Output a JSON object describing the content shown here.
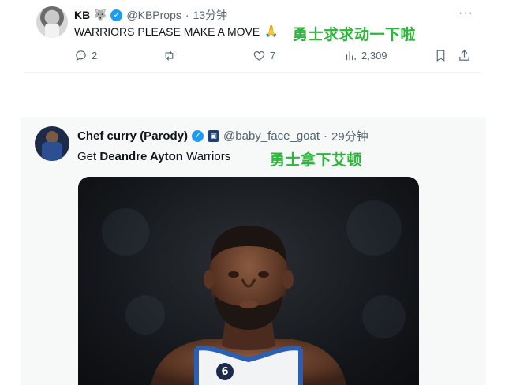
{
  "tweet1": {
    "name": "KB",
    "emoji": "🐺",
    "handle": "@KBProps",
    "dot": "·",
    "time": "13分钟",
    "text": "WARRIORS PLEASE MAKE A MOVE",
    "text_emoji": "🙏",
    "caption_cn": "勇士求求动一下啦",
    "replies": "2",
    "likes": "7",
    "views": "2,309",
    "more": "···"
  },
  "tweet2": {
    "name": "Chef curry (Parody)",
    "handle": "@baby_face_goat",
    "dot": "·",
    "time": "29分钟",
    "text_pre": "Get ",
    "text_bold": "Deandre Ayton",
    "text_post": " Warriors",
    "caption_cn": "勇士拿下艾顿",
    "jersey_number": "6"
  },
  "colors": {
    "accent": "#1d9bf0",
    "caption_green": "#2bb63a",
    "muted": "#536471"
  },
  "icons": [
    "wolf-emoji-icon",
    "verified-badge-icon",
    "more-icon",
    "reply-icon",
    "retweet-icon",
    "like-icon",
    "views-icon",
    "bookmark-icon",
    "share-icon",
    "team-badge-icon"
  ]
}
